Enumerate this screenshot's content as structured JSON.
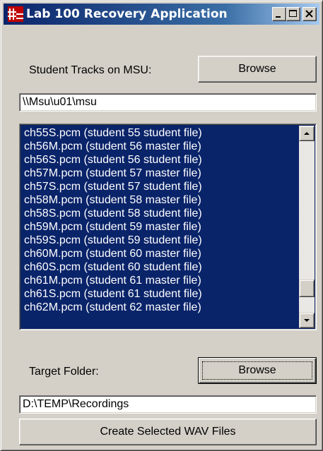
{
  "window": {
    "title": "Lab 100 Recovery Application",
    "icon": "app-icon",
    "controls": {
      "minimize_icon": "minimize-icon",
      "maximize_icon": "maximize-icon",
      "close_icon": "close-icon"
    }
  },
  "source": {
    "label": "Student Tracks on MSU:",
    "browse_label": "Browse",
    "path_value": "\\\\Msu\\u01\\msu"
  },
  "file_list": {
    "items": [
      "ch55S.pcm (student 55 student file)",
      "ch56M.pcm (student 56 master file)",
      "ch56S.pcm (student 56 student file)",
      "ch57M.pcm (student 57 master file)",
      "ch57S.pcm (student 57 student file)",
      "ch58M.pcm (student 58 master file)",
      "ch58S.pcm (student 58 student file)",
      "ch59M.pcm (student 59 master file)",
      "ch59S.pcm (student 59 student file)",
      "ch60M.pcm (student 60 master file)",
      "ch60S.pcm (student 60 student file)",
      "ch61M.pcm (student 61 master file)",
      "ch61S.pcm (student 61 student file)",
      "ch62M.pcm (student 62 master file)"
    ],
    "all_selected": true,
    "selection_color": "#0a246a",
    "scroll_position": 0.9,
    "scroll_up_icon": "scroll-up-arrow-icon",
    "scroll_down_icon": "scroll-down-arrow-icon"
  },
  "target": {
    "label": "Target Folder:",
    "browse_label": "Browse",
    "path_value": "D:\\TEMP\\Recordings"
  },
  "actions": {
    "create_label": "Create Selected WAV Files"
  },
  "colors": {
    "face": "#d4d0c8",
    "title_active": "#0a246a",
    "title_gradient_end": "#a6caf0",
    "selection": "#0a246a"
  }
}
